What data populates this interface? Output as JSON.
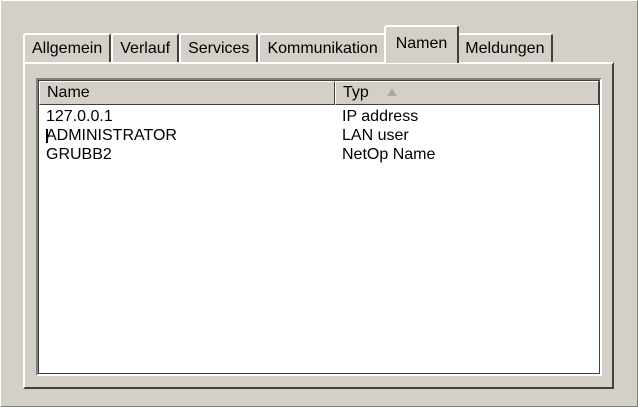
{
  "tabs": [
    {
      "label": "Allgemein",
      "active": false
    },
    {
      "label": "Verlauf",
      "active": false
    },
    {
      "label": "Services",
      "active": false
    },
    {
      "label": "Kommunikation",
      "active": false
    },
    {
      "label": "Namen",
      "active": true
    },
    {
      "label": "Meldungen",
      "active": false
    }
  ],
  "list": {
    "columns": [
      {
        "label": "Name"
      },
      {
        "label": "Typ",
        "sort": "ascending"
      }
    ],
    "rows": [
      {
        "name": "127.0.0.1",
        "type": "IP address"
      },
      {
        "name": "ADMINISTRATOR",
        "type": "LAN user"
      },
      {
        "name": "GRUBB2",
        "type": "NetOp Name"
      }
    ]
  },
  "colors": {
    "face": "#d4d0c8",
    "list_bg": "#ffffff"
  }
}
